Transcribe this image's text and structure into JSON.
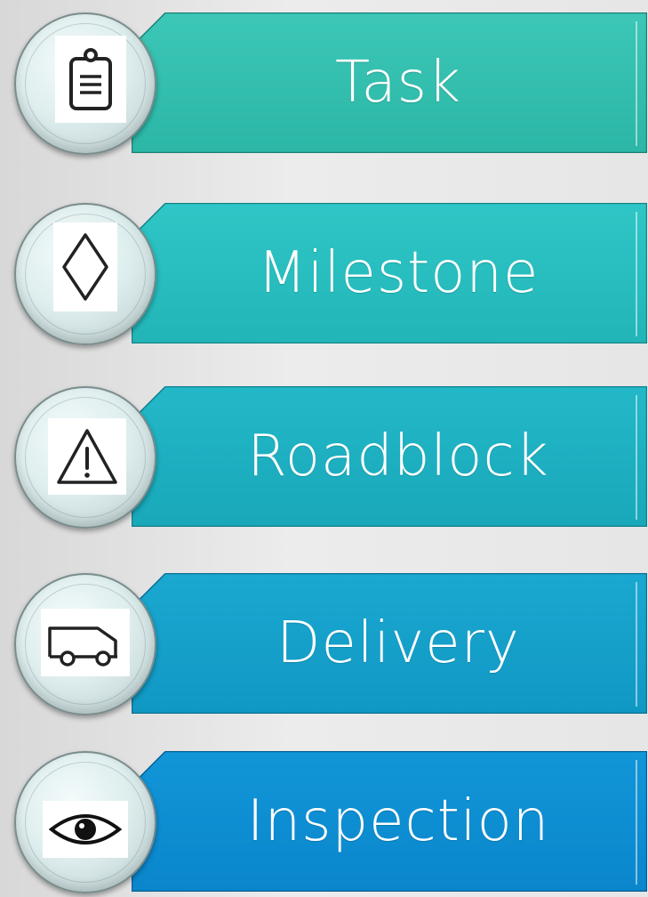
{
  "items": [
    {
      "label": "Task",
      "icon": "clipboard-icon",
      "color_top": "#3cc7b7",
      "color_bottom": "#2bb6a6"
    },
    {
      "label": "Milestone",
      "icon": "diamond-icon",
      "color_top": "#2fc6c6",
      "color_bottom": "#22b5b8"
    },
    {
      "label": "Roadblock",
      "icon": "warning-icon",
      "color_top": "#23b8c8",
      "color_bottom": "#18a8ba"
    },
    {
      "label": "Delivery",
      "icon": "truck-icon",
      "color_top": "#1aa8d0",
      "color_bottom": "#1098c4"
    },
    {
      "label": "Inspection",
      "icon": "eye-icon",
      "color_top": "#1296d8",
      "color_bottom": "#0a86cc"
    }
  ]
}
